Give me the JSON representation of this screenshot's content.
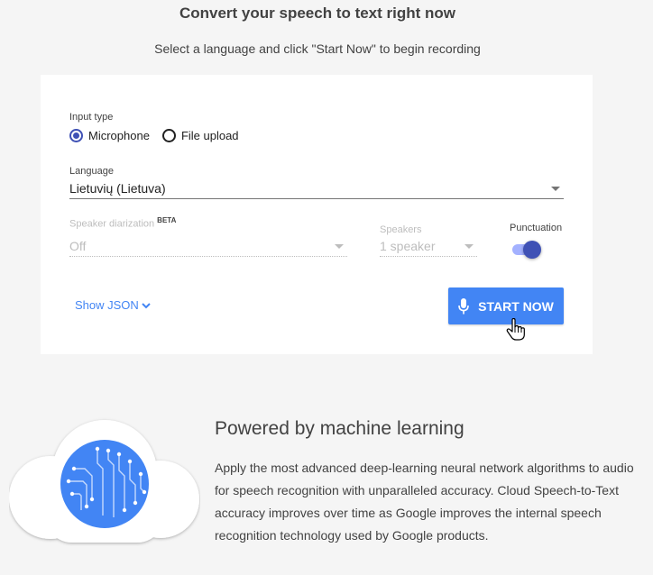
{
  "header": {
    "title": "Convert your speech to text right now",
    "subtitle": "Select a language and click \"Start Now\" to begin recording"
  },
  "form": {
    "input_type": {
      "label": "Input type",
      "options": [
        "Microphone",
        "File upload"
      ],
      "selected": "Microphone"
    },
    "language": {
      "label": "Language",
      "value": "Lietuvių (Lietuva)"
    },
    "diarization": {
      "label": "Speaker diarization",
      "badge": "BETA",
      "value": "Off"
    },
    "speakers": {
      "label": "Speakers",
      "value": "1 speaker"
    },
    "punctuation": {
      "label": "Punctuation",
      "enabled": true
    },
    "show_json_label": "Show JSON",
    "start_label": "START NOW"
  },
  "feature": {
    "title": "Powered by machine learning",
    "body": "Apply the most advanced deep-learning neural network algorithms to audio for speech recognition with unparalleled accuracy. Cloud Speech-to-Text accuracy improves over time as Google improves the internal speech recognition technology used by Google products."
  },
  "colors": {
    "accent_blue": "#4285f4",
    "indigo": "#3f51b5",
    "background": "#f5f5f5"
  },
  "icons": [
    "microphone-icon",
    "chevron-down-icon",
    "hand-pointer-cursor",
    "cloud-circuit-icon"
  ]
}
